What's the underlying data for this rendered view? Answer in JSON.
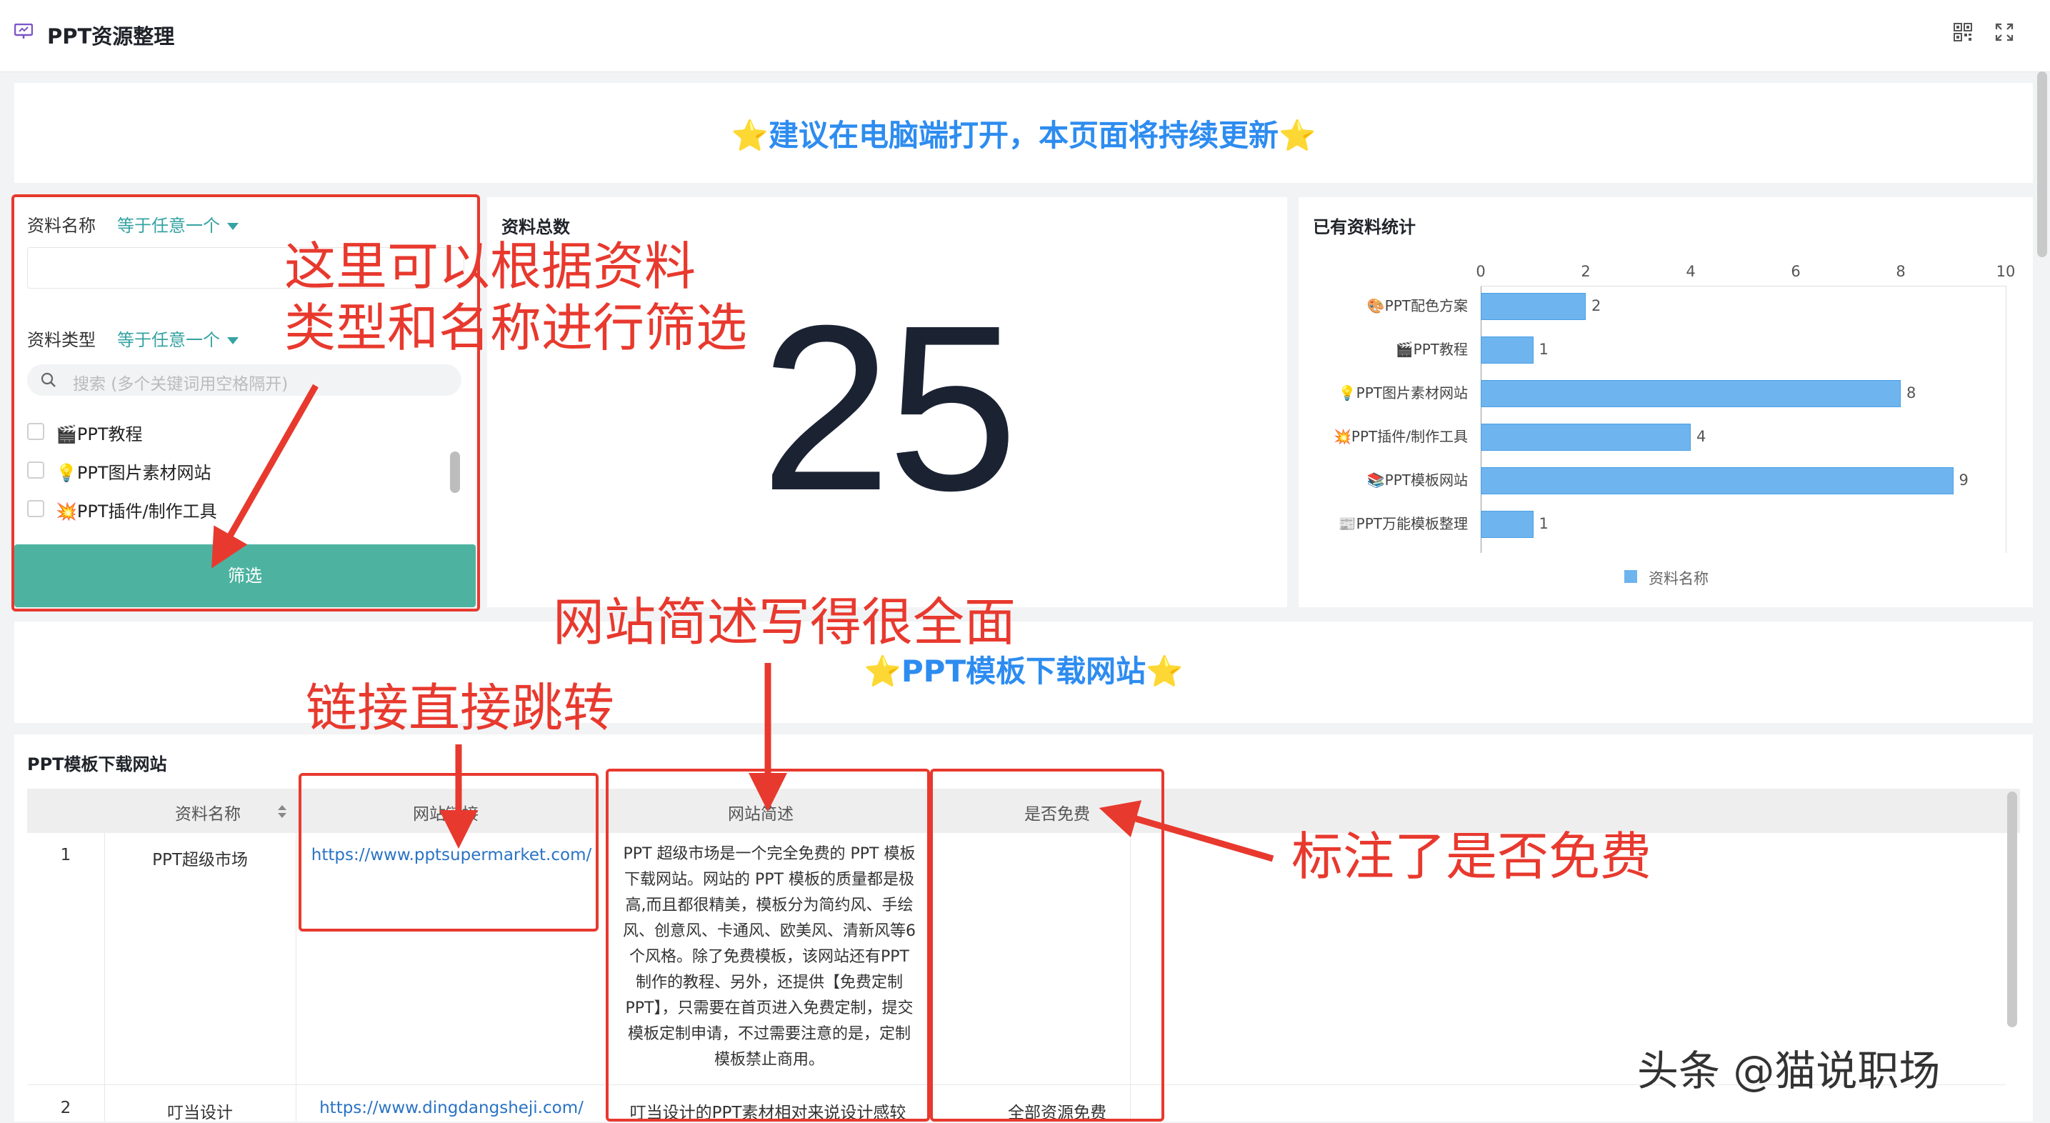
{
  "app": {
    "title": "PPT资源整理",
    "icon": "presentation-icon"
  },
  "topbar_icons": [
    "qr-code-icon",
    "fullscreen-icon"
  ],
  "banner": {
    "text": "⭐建议在电脑端打开，本页面将持续更新⭐"
  },
  "filter": {
    "name_label": "资料名称",
    "name_operator": "等于任意一个",
    "type_label": "资料类型",
    "type_operator": "等于任意一个",
    "search_placeholder": "搜索 (多个关键词用空格隔开)",
    "options": [
      "🎬PPT教程",
      "💡PPT图片素材网站",
      "💥PPT插件/制作工具"
    ],
    "button_label": "筛选"
  },
  "total": {
    "title": "资料总数",
    "value": "25"
  },
  "chart_data": {
    "type": "bar",
    "orientation": "horizontal",
    "title": "已有资料统计",
    "categories": [
      "🎨PPT配色方案",
      "🎬PPT教程",
      "💡PPT图片素材网站",
      "💥PPT插件/制作工具",
      "📚PPT模板网站",
      "📰PPT万能模板整理"
    ],
    "series": [
      {
        "name": "资料名称",
        "values": [
          2,
          1,
          8,
          4,
          9,
          1
        ]
      }
    ],
    "xlim": [
      0,
      10
    ],
    "xticks": [
      "0",
      "2",
      "4",
      "6",
      "8",
      "10"
    ],
    "legend_position": "bottom",
    "grid": false,
    "color": "#6eb4ee"
  },
  "section": {
    "banner": "⭐PPT模板下载网站⭐",
    "table_title": "PPT模板下载网站"
  },
  "table": {
    "headers": [
      "资料名称",
      "网站链接",
      "网站简述",
      "是否免费"
    ],
    "rows": [
      {
        "index": "1",
        "name": "PPT超级市场",
        "link": "https://www.pptsupermarket.com/",
        "desc": "PPT 超级市场是一个完全免费的 PPT 模板下载网站。网站的 PPT 模板的质量都是极高,而且都很精美，模板分为简约风、手绘风、创意风、卡通风、欧美风、清新风等6个风格。除了免费模板，该网站还有PPT制作的教程、另外，还提供【免费定制PPT】，只需要在首页进入免费定制，提交模板定制申请，不过需要注意的是，定制模板禁止商用。",
        "free": ""
      },
      {
        "index": "2",
        "name": "叮当设计",
        "link": "https://www.dingdangsheji.com/",
        "desc": "叮当设计的PPT素材相对来说设计感较",
        "free": "全部资源免费"
      }
    ]
  },
  "annotations": {
    "filter": "这里可以根据资料\n类型和名称进行筛选",
    "desc": "网站简述写得很全面",
    "link": "链接直接跳转",
    "free": "标注了是否免费"
  },
  "watermark": "头条 @猫说职场"
}
